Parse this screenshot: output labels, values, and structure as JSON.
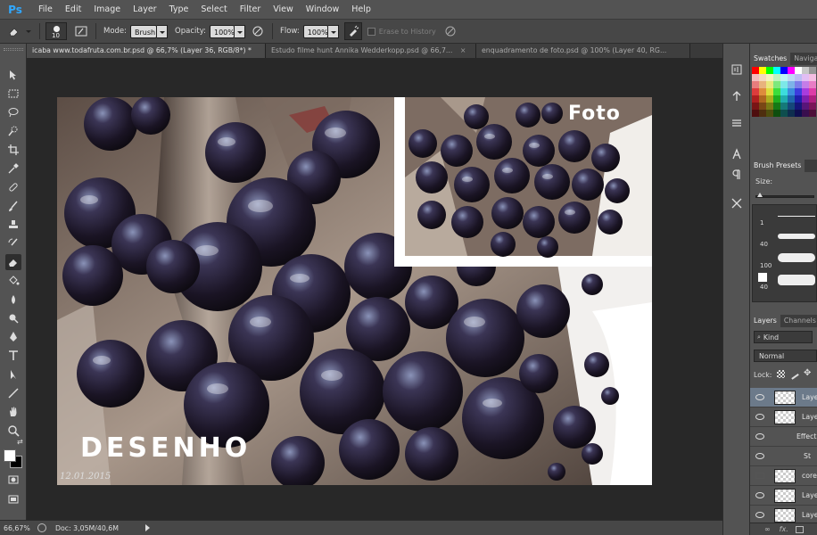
{
  "app": {
    "logo": "Ps"
  },
  "menu": [
    "File",
    "Edit",
    "Image",
    "Layer",
    "Type",
    "Select",
    "Filter",
    "View",
    "Window",
    "Help"
  ],
  "options": {
    "brush_size": "10",
    "mode_label": "Mode:",
    "mode_value": "Brush",
    "opacity_label": "Opacity:",
    "opacity_value": "100%",
    "flow_label": "Flow:",
    "flow_value": "100%",
    "erase_history_label": "Erase to History"
  },
  "tabs": [
    {
      "label": "icaba www.todafruta.com.br.psd @ 66,7% (Layer 36, RGB/8*) *",
      "active": true
    },
    {
      "label": "Estudo filme hunt Annika Wedderkopp.psd @ 66,7...",
      "active": false
    },
    {
      "label": "enquadramento de foto.psd @ 100% (Layer 40, RG...",
      "active": false
    }
  ],
  "canvas": {
    "foto_text": "Foto",
    "desenho_text": "DESENHO",
    "signature": "12.01.2015"
  },
  "status": {
    "zoom": "66,67%",
    "doc": "Doc: 3,05M/40,6M"
  },
  "panels": {
    "swatches_tab": "Swatches",
    "navigator_tab": "Naviga",
    "brush_presets_tab": "Brush Presets",
    "size_label": "Size:",
    "brush_sizes": [
      "1",
      "40",
      "100",
      "40"
    ],
    "layers_tab": "Layers",
    "channels_tab": "Channels",
    "kind_label": "Kind",
    "blend_mode": "Normal",
    "lock_label": "Lock:",
    "layers": [
      {
        "name": "Laye",
        "visible": true,
        "selected": true
      },
      {
        "name": "Laye",
        "visible": true,
        "selected": false
      },
      {
        "name": "Effect",
        "visible": true,
        "selected": false
      },
      {
        "name": "St",
        "visible": true,
        "selected": false
      },
      {
        "name": "core",
        "visible": false,
        "selected": false
      },
      {
        "name": "Laye",
        "visible": true,
        "selected": false
      },
      {
        "name": "Laye",
        "visible": true,
        "selected": false
      }
    ]
  },
  "colors": {
    "menubar_bg": "#535353",
    "optionsbar_bg": "#474747",
    "workspace_bg": "#282828",
    "selected_layer": "#6c7a8a",
    "ps_blue": "#31a8ff"
  }
}
